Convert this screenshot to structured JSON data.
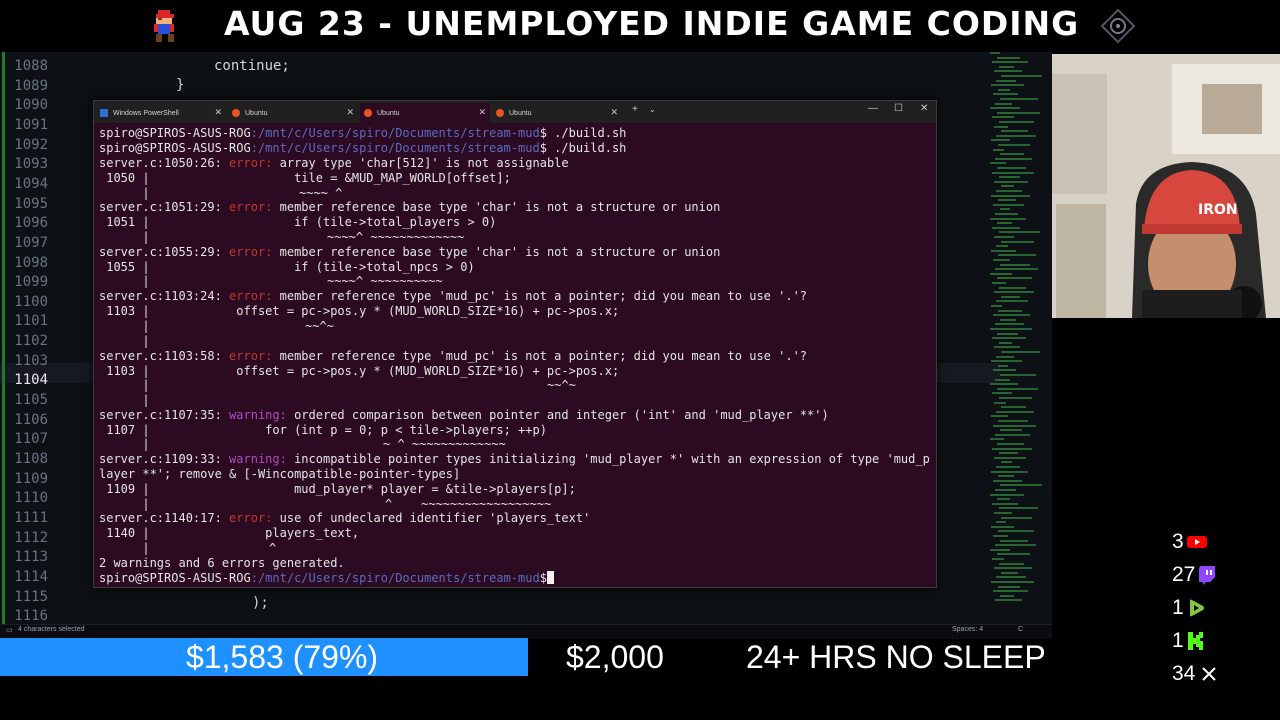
{
  "banner": {
    "title": "AUG 23 - UNEMPLOYED INDIE GAME CODING"
  },
  "editor": {
    "line_numbers": [
      "1088",
      "1089",
      "1090",
      "1091",
      "1092",
      "1093",
      "1094",
      "1095",
      "1096",
      "1097",
      "1098",
      "1099",
      "1100",
      "1101",
      "1102",
      "1103",
      "1104",
      "1105",
      "1106",
      "1107",
      "1108",
      "1109",
      "1110",
      "1111",
      "1112",
      "1113",
      "1114",
      "1115",
      "1116"
    ],
    "current_line": "1104",
    "code_continue": "continue;",
    "code_brace": "}",
    "code_close": ");",
    "status_left": "4 characters selected",
    "status_spaces": "Spaces: 4",
    "status_lang": "C"
  },
  "terminal": {
    "tabs": [
      {
        "label": "Windows PowerShell",
        "active": false
      },
      {
        "label": "Ubuntu",
        "active": false
      },
      {
        "label": "Ubuntu",
        "active": true
      },
      {
        "label": "Ubuntu",
        "active": false
      }
    ],
    "new_tab": "+",
    "tab_dropdown": "⌄",
    "minimize": "—",
    "maximize": "☐",
    "close": "✕",
    "prompt_user": "spiro@SPIROS-ASUS-ROG",
    "prompt_path": ":/mnt/c/Users/spiro/Documents/stream-mud",
    "cmd1": "$ ./build.sh",
    "cmd2": "$ ./build.sh",
    "l_e1_loc": "server.c:1050:26: ",
    "l_e1_tag": "error:",
    "l_e1_msg": " array type 'char[512]' is not assignable",
    "l_e1_src": " 1050 |                    tile = &MUD_MAP_WORLD[offset];",
    "l_e1_bar": "      |",
    "l_e1_car": "~~~~ ^",
    "l_e2_loc": "server.c:1051:29: ",
    "l_e2_tag": "error:",
    "l_e2_msg": " member reference base type 'char' is not a structure or union",
    "l_e2_src": " 1051 |                    if (tile->total_players > 0)",
    "l_e2_bar": "      |",
    "l_e2_car": "~~~~^ ~~~~~~~~~~~~~",
    "l_e3_loc": "server.c:1055:29: ",
    "l_e3_tag": "error:",
    "l_e3_msg": " member reference base type 'char' is not a structure or union",
    "l_e3_src": " 1055 |                    if (tile->total_npcs > 0)",
    "l_e3_bar": "      |",
    "l_e3_car": "~~~~^ ~~~~~~~~~~",
    "l_e4_loc": "server.c:1103:24: ",
    "l_e4_tag": "error:",
    "l_e4_msg": " member reference type 'mud_pc' is not a pointer; did you mean to use '.'?",
    "l_e4_src": " 1103 |            offset = pc->pos.y * (MUD_WORLD_SIZE*16) + pc->pos.x;",
    "l_e4_bar": "      |",
    "l_e4_car": "~~^~",
    "l_e4_bar2": "      |",
    "l_e5_loc": "server.c:1103:58: ",
    "l_e5_tag": "error:",
    "l_e5_msg": " member reference type 'mud_pc' is not a pointer; did you mean to use '.'?",
    "l_e5_src": " 1103 |            offset = pc->pos.y * (MUD_WORLD_SIZE*16) + pc->pos.x;",
    "l_e5_bar": "      |",
    "l_e5_car": "~~^~",
    "l_e5_bar2": "      |",
    "l_w1_loc": "server.c:1107:35: ",
    "l_w1_tag": "warning:",
    "l_w1_msg": " ordered comparison between pointer and integer ('int' and 'mud_player **')",
    "l_w1_src": " 1107 |                for (int p = 0; p < tile->players; ++p)",
    "l_w1_bar": "      |",
    "l_w1_car": "~ ^ ~~~~~~~~~~~~~",
    "l_w2_loc": "server.c:1109:33: ",
    "l_w2_tag": "warning:",
    "l_w2_msg": " incompatible pointer types initializing 'mud_player *' with an expression of type 'mud_p",
    "l_w2_msg2": "layer **'; remove & [-Wincompatible-pointer-types]",
    "l_w2_src": " 1109 |                    mud_player* player = &tile->players[p];",
    "l_w2_bar": "      |",
    "l_w2_car": "^    ~~~~~~~~~~~~~~~~~~",
    "l_e6_loc": "server.c:1140:17: ",
    "l_e6_tag": "error:",
    "l_e6_msg": " use of undeclared identifier 'players_text'",
    "l_e6_src": " 1140 |                players_text,",
    "l_e6_bar": "      |",
    "l_e6_car": "^",
    "summary": "2 warnings and 6 errors generated.",
    "cmd3": "$ "
  },
  "stats": [
    {
      "value": "3",
      "icon": "youtube-icon",
      "color": "#ff0000"
    },
    {
      "value": "27",
      "icon": "twitch-icon",
      "color": "#9146ff"
    },
    {
      "value": "1",
      "icon": "rumble-icon",
      "color": "#85c742"
    },
    {
      "value": "1",
      "icon": "kick-icon",
      "color": "#53fc18"
    },
    {
      "value": "34",
      "icon": "x-icon",
      "color": "#ffffff"
    }
  ],
  "goal": {
    "current": "$1,583 (79%)",
    "progress": 0.79,
    "target": "$2,000",
    "message": "24+ HRS NO SLEEP",
    "color": "#1e90ff"
  }
}
